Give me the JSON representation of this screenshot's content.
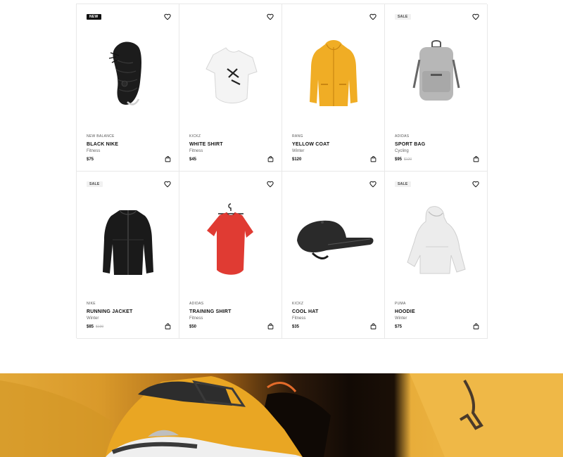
{
  "products": [
    {
      "badge": "NEW",
      "badge_type": "new",
      "brand": "NEW BALANCE",
      "name": "BLACK NIKE",
      "category": "Fitness",
      "price": "$75",
      "old_price": "",
      "image": "black-sneaker"
    },
    {
      "badge": "",
      "badge_type": "",
      "brand": "KICKZ",
      "name": "WHITE SHIRT",
      "category": "Fitness",
      "price": "$45",
      "old_price": "",
      "image": "white-tshirt"
    },
    {
      "badge": "",
      "badge_type": "",
      "brand": "RANG",
      "name": "YELLOW COAT",
      "category": "Winter",
      "price": "$120",
      "old_price": "",
      "image": "yellow-coat"
    },
    {
      "badge": "SALE",
      "badge_type": "sale",
      "brand": "ADIDAS",
      "name": "SPORT BAG",
      "category": "Cycling",
      "price": "$95",
      "old_price": "$120",
      "image": "grey-backpack"
    },
    {
      "badge": "SALE",
      "badge_type": "sale",
      "brand": "NIKE",
      "name": "RUNNING JACKET",
      "category": "Winter",
      "price": "$85",
      "old_price": "$100",
      "image": "black-jacket"
    },
    {
      "badge": "",
      "badge_type": "",
      "brand": "ADIDAS",
      "name": "TRAINING SHIRT",
      "category": "Fitness",
      "price": "$50",
      "old_price": "",
      "image": "red-shirt"
    },
    {
      "badge": "",
      "badge_type": "",
      "brand": "KICKZ",
      "name": "COOL HAT",
      "category": "Fitness",
      "price": "$35",
      "old_price": "",
      "image": "black-cap"
    },
    {
      "badge": "SALE",
      "badge_type": "sale",
      "brand": "PUMA",
      "name": "HOODIE",
      "category": "Winter",
      "price": "$75",
      "old_price": "",
      "image": "white-hoodie"
    }
  ],
  "icons": {
    "favorite": "heart-icon",
    "cart": "shopping-bag-icon"
  },
  "colors": {
    "text": "#111111",
    "border": "#e8e8e8",
    "banner_accent": "#e2a838"
  },
  "banner": {
    "image": "yellow-sneaker-banner"
  }
}
